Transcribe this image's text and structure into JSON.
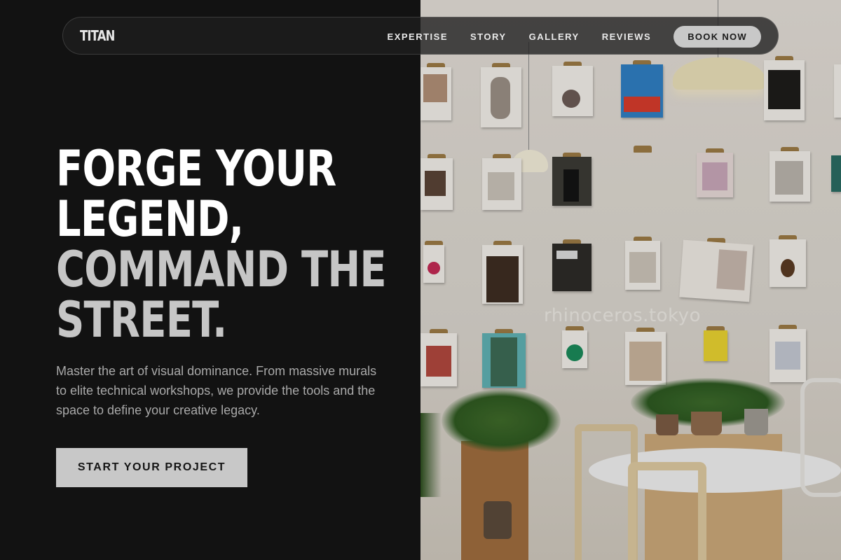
{
  "nav": {
    "logo": "TITAN",
    "links": [
      "EXPERTISE",
      "STORY",
      "GALLERY",
      "REVIEWS"
    ],
    "book_label": "BOOK NOW"
  },
  "hero": {
    "line1": "FORGE YOUR",
    "line2": "LEGEND,",
    "line3": "COMMAND THE",
    "line4": "STREET.",
    "description": "Master the art of visual dominance. From massive murals to elite technical workshops, we provide the tools and the space to define your creative legacy.",
    "cta_label": "START YOUR PROJECT"
  },
  "photo": {
    "watermark": "rhinoceros.tokyo"
  },
  "colors": {
    "background": "#121212",
    "accent_button": "#c8c8c8",
    "headline_white": "#ffffff",
    "headline_grey": "#c6c6c6",
    "body_text": "#a9a9a9"
  }
}
